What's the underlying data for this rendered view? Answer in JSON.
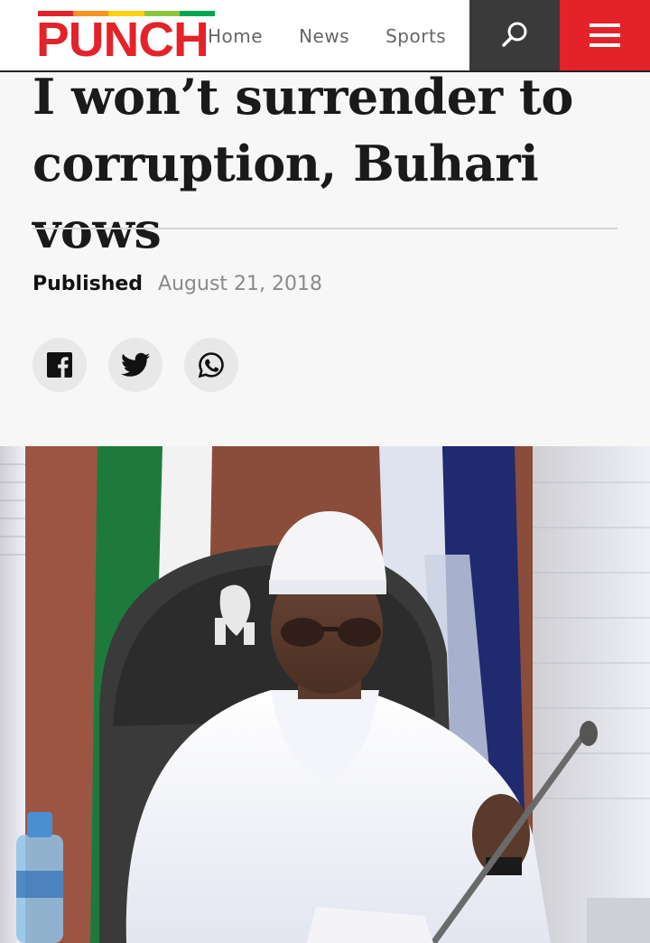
{
  "header": {
    "logo_text": "PUNCH",
    "nav": [
      {
        "label": "Home"
      },
      {
        "label": "News"
      },
      {
        "label": "Sports"
      }
    ],
    "search_icon": "search-icon",
    "menu_icon": "hamburger-menu-icon",
    "colors": {
      "brand_red": "#e4222a",
      "search_bg": "#3a3a3a"
    }
  },
  "article": {
    "headline": "I won’t surrender to corruption, Buhari vows",
    "published_label": "Published",
    "published_date": "August 21, 2018",
    "share": [
      {
        "icon": "facebook-icon"
      },
      {
        "icon": "twitter-icon"
      },
      {
        "icon": "whatsapp-icon"
      }
    ],
    "photo_icon": "article-photo"
  }
}
